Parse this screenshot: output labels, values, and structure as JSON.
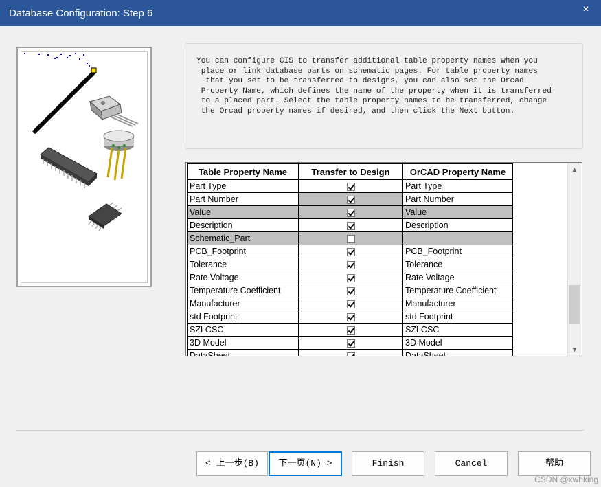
{
  "window": {
    "title": "Database Configuration: Step 6",
    "close_glyph": "×"
  },
  "description": "You can configure CIS to transfer additional table property names when you\n place or link database parts on schematic pages. For table property names\n  that you set to be transferred to designs, you can also set the Orcad\n Property Name, which defines the name of the property when it is transferred\n to a placed part. Select the table property names to be transferred, change\n the Orcad property names if desired, and then click the Next button.",
  "grid": {
    "headers": [
      "Table Property Name",
      "Transfer to Design",
      "OrCAD Property Name"
    ],
    "rows": [
      {
        "name": "Part Type",
        "transfer": true,
        "orcad": "Part Type",
        "shaded": false,
        "chk_shaded": false
      },
      {
        "name": "Part Number",
        "transfer": true,
        "orcad": "Part Number",
        "shaded": false,
        "chk_shaded": true
      },
      {
        "name": "Value",
        "transfer": true,
        "orcad": "Value",
        "shaded": true,
        "chk_shaded": true
      },
      {
        "name": "Description",
        "transfer": true,
        "orcad": "Description",
        "shaded": false,
        "chk_shaded": false
      },
      {
        "name": "Schematic_Part",
        "transfer": false,
        "orcad": "",
        "shaded": true,
        "chk_shaded": true
      },
      {
        "name": "PCB_Footprint",
        "transfer": true,
        "orcad": "PCB_Footprint",
        "shaded": false,
        "chk_shaded": false
      },
      {
        "name": "Tolerance",
        "transfer": true,
        "orcad": "Tolerance",
        "shaded": false,
        "chk_shaded": false
      },
      {
        "name": "Rate Voltage",
        "transfer": true,
        "orcad": "Rate Voltage",
        "shaded": false,
        "chk_shaded": false
      },
      {
        "name": "Temperature Coefficient",
        "transfer": true,
        "orcad": "Temperature Coefficient",
        "shaded": false,
        "chk_shaded": false
      },
      {
        "name": "Manufacturer",
        "transfer": true,
        "orcad": "Manufacturer",
        "shaded": false,
        "chk_shaded": false
      },
      {
        "name": "std Footprint",
        "transfer": true,
        "orcad": "std Footprint",
        "shaded": false,
        "chk_shaded": false
      },
      {
        "name": "SZLCSC",
        "transfer": true,
        "orcad": "SZLCSC",
        "shaded": false,
        "chk_shaded": false
      },
      {
        "name": "3D Model",
        "transfer": true,
        "orcad": "3D Model",
        "shaded": false,
        "chk_shaded": false
      },
      {
        "name": "DataSheet",
        "transfer": true,
        "orcad": "DataSheet",
        "shaded": false,
        "chk_shaded": false
      }
    ],
    "scroll_up_glyph": "▲",
    "scroll_down_glyph": "▼",
    "scroll_position": 0.85
  },
  "buttons": {
    "back": "< 上一步(B)",
    "next": "下一页(N) >",
    "finish": "Finish",
    "cancel": "Cancel",
    "help": "帮助"
  },
  "watermark": "CSDN @xwhking",
  "colors": {
    "titlebar": "#2b579a",
    "focus_border": "#0078d7",
    "shaded_row": "#c0c0c0"
  }
}
